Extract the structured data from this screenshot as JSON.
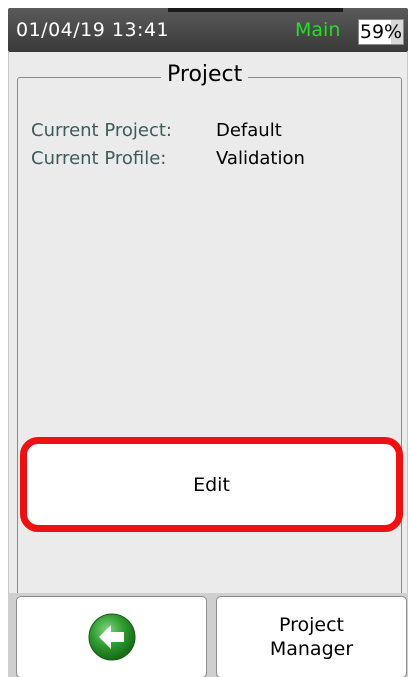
{
  "status": {
    "datetime": "01/04/19 13:41",
    "mode": "Main",
    "battery": "59%",
    "battery_level": 0.59,
    "mode_color": "#22e022"
  },
  "panel": {
    "title": "Project",
    "rows": [
      {
        "label": "Current Project:",
        "value": "Default"
      },
      {
        "label": "Current Profile:",
        "value": "Validation"
      }
    ]
  },
  "edit_label": "Edit",
  "footer": {
    "back_icon": "back-arrow-icon",
    "project_manager_line1": "Project",
    "project_manager_line2": "Manager"
  },
  "colors": {
    "highlight": "#ee1111",
    "back_icon_green": "#2e9a2e"
  }
}
